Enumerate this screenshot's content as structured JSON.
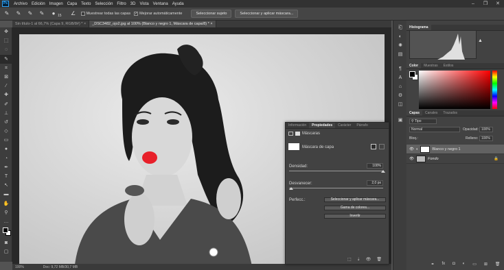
{
  "menubar": {
    "logo": "Ps",
    "items": [
      "Archivo",
      "Edición",
      "Imagen",
      "Capa",
      "Texto",
      "Selección",
      "Filtro",
      "3D",
      "Vista",
      "Ventana",
      "Ayuda"
    ]
  },
  "options_bar": {
    "brush_size": "15",
    "sample_all_layers": "Muestrear todas las capas",
    "auto_enhance": "Mejorar automáticamente",
    "select_subject": "Seleccionar sujeto",
    "select_and_mask": "Seleccionar y aplicar máscara..."
  },
  "doc_tabs": [
    {
      "label": "Sin título-1 al 66,7% (Capa 9, RGB/8#) *",
      "close": "×"
    },
    {
      "label": "_DSC3482_ojo2.jpg al 100% (Blanco y negro 1, Máscara de capa/8) *",
      "close": "×"
    }
  ],
  "status": {
    "zoom": "100%",
    "doc": "Doc: 9,72 MB/30,7 MB"
  },
  "histogram": {
    "tab": "Histograma"
  },
  "color_panel": {
    "tabs": [
      "Color",
      "Muestras",
      "Estilos"
    ],
    "fg": "#000000",
    "bg": "#ffffff"
  },
  "layers_panel": {
    "tabs": [
      "Capas",
      "Canales",
      "Trazados"
    ],
    "filter": "Tipo",
    "blend_mode": "Normal",
    "opacity_label": "Opacidad:",
    "opacity": "100%",
    "lock_label": "Bloq.:",
    "fill_label": "Relleno:",
    "fill": "100%",
    "layers": [
      {
        "name": "Blanco y negro 1",
        "selected": true
      },
      {
        "name": "Fondo",
        "selected": false
      }
    ]
  },
  "properties_panel": {
    "tabs": [
      "Información",
      "Propiedades",
      "Carácter",
      "Párrafo"
    ],
    "section": "Máscaras",
    "mask_type": "Máscara de capa",
    "density_label": "Densidad:",
    "density": "100%",
    "density_level": 1.0,
    "feather_label": "Desvanecer:",
    "feather": "2,0 px",
    "feather_level": 0.02,
    "refine_label": "Perfecc.:",
    "btn_select_mask": "Seleccionar y aplicar máscara...",
    "btn_color_range": "Gama de colores...",
    "btn_invert": "Invertir"
  },
  "colors": {
    "accent": "#31a8ff",
    "lips": "#e8202a",
    "panel": "#424242",
    "chrome": "#323232"
  }
}
